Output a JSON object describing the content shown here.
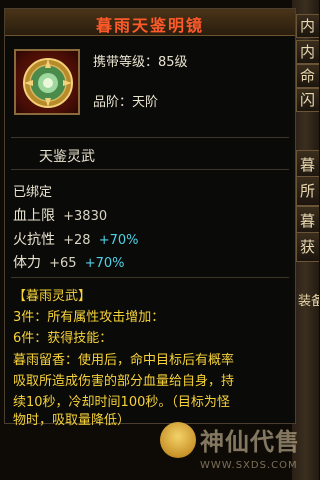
{
  "item": {
    "name": "暮雨天鉴明镜",
    "carry_level": "携带等级：85级",
    "grade": "品阶：天阶",
    "subtitle": "天鉴灵武",
    "bound": "已绑定",
    "stats": [
      {
        "label": "血上限",
        "value": "+3830",
        "bonus": ""
      },
      {
        "label": "火抗性",
        "value": "+28",
        "bonus": "+70%"
      },
      {
        "label": "体力",
        "value": "+65",
        "bonus": "+70%"
      }
    ],
    "set": {
      "header": "【暮雨灵武】",
      "line1": "3件：所有属性攻击增加：",
      "line2": "6件：获得技能：",
      "desc": [
        "暮雨留香：使用后，命中目标后有概率",
        "吸取所造成伤害的部分血量给自身，持",
        "续10秒，冷却时间100秒。（目标为怪",
        "物时，吸取量降低）"
      ]
    }
  },
  "side_panel": {
    "tabs": [
      "内",
      "内",
      "命",
      "闪",
      "暮",
      "所",
      "暮",
      "获"
    ],
    "label": "装备"
  },
  "watermark": {
    "text": "神仙代售",
    "url": "WWW.SXDS.COM"
  },
  "colors": {
    "title": "#ff5a2a",
    "stat_white": "#e8e2d0",
    "bonus_cyan": "#4fd2e8",
    "set_yellow": "#f6d23a"
  }
}
